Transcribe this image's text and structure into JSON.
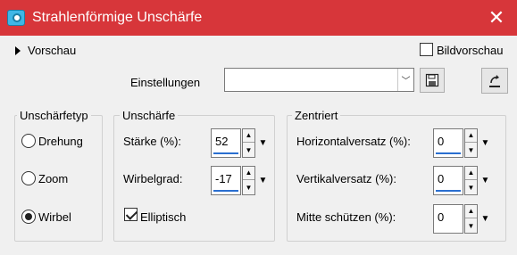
{
  "window": {
    "title": "Strahlenförmige Unschärfe",
    "close_glyph": "✕",
    "accent_color": "#d7363a"
  },
  "preview": {
    "label": "Vorschau",
    "bild_label": "Bildvorschau",
    "bild_checked": false
  },
  "settings": {
    "label": "Einstellungen",
    "value": "",
    "dropdown_glyph": "﹀"
  },
  "type_group": {
    "title": "Unschärfetyp",
    "options": [
      {
        "label": "Drehung",
        "checked": false
      },
      {
        "label": "Zoom",
        "checked": false
      },
      {
        "label": "Wirbel",
        "checked": true
      }
    ]
  },
  "blur_group": {
    "title": "Unschärfe",
    "staerke_label": "Stärke (%):",
    "staerke_value": "52",
    "wirbel_label": "Wirbelgrad:",
    "wirbel_value": "-17",
    "elliptisch_label": "Elliptisch",
    "elliptisch_checked": true
  },
  "center_group": {
    "title": "Zentriert",
    "h_label": "Horizontalversatz (%):",
    "h_value": "0",
    "v_label": "Vertikalversatz (%):",
    "v_value": "0",
    "m_label": "Mitte schützen (%):",
    "m_value": "0"
  },
  "icons": {
    "app": "camera-icon",
    "save": "save-icon",
    "reset": "reset-icon"
  },
  "spin_glyphs": {
    "up": "▲",
    "down": "▼",
    "drop": "▼"
  }
}
